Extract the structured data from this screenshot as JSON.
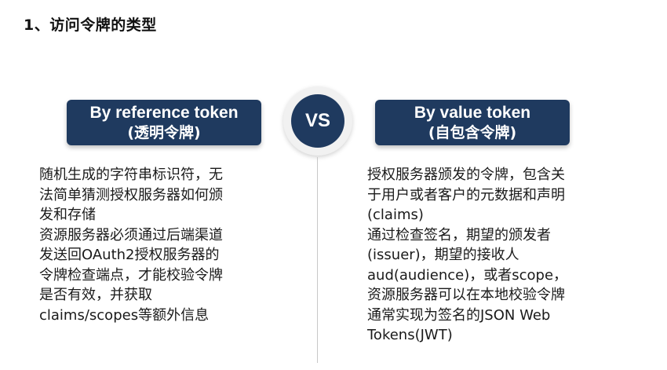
{
  "heading": "1、访问令牌的类型",
  "vs_label": "VS",
  "left": {
    "title": "By reference token",
    "subtitle": "(透明令牌)",
    "lines": [
      "随机生成的字符串标识符，无",
      "法简单猜测授权服务器如何颁",
      "发和存储",
      "资源服务器必须通过后端渠道",
      "发送回OAuth2授权服务器的",
      "令牌检查端点，才能校验令牌",
      "是否有效，并获取",
      "claims/scopes等额外信息"
    ]
  },
  "right": {
    "title": "By value token",
    "subtitle": "(自包含令牌)",
    "lines": [
      "授权服务器颁发的令牌，包含关",
      "于用户或者客户的元数据和声明",
      "(claims)",
      "通过检查签名，期望的颁发者",
      "(issuer)，期望的接收人",
      "aud(audience)，或者scope，",
      "资源服务器可以在本地校验令牌",
      "通常实现为签名的JSON Web",
      "Tokens(JWT)"
    ]
  },
  "colors": {
    "navy": "#1f3a5f",
    "text": "#1a1a1a",
    "divider": "#c8c8c8"
  }
}
